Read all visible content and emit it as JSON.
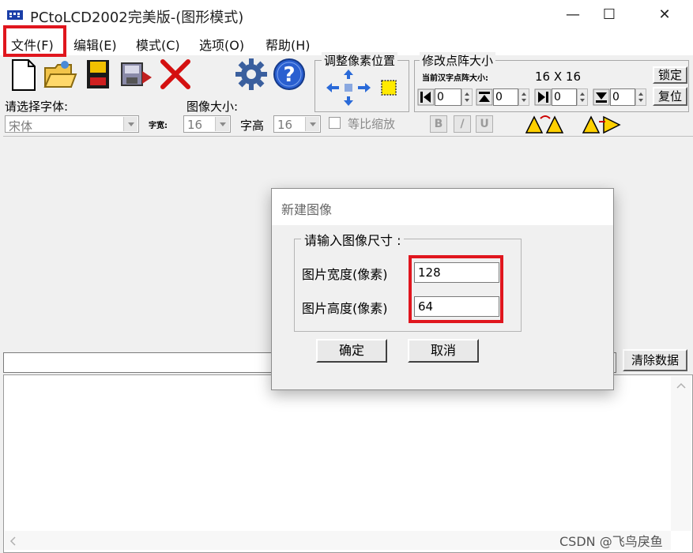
{
  "window": {
    "title": "PCtoLCD2002完美版-(图形模式)",
    "minimize_glyph": "—",
    "maximize_glyph": "☐",
    "close_glyph": "✕"
  },
  "menu": {
    "items": [
      {
        "label": "文件(F)"
      },
      {
        "label": "编辑(E)"
      },
      {
        "label": "模式(C)"
      },
      {
        "label": "选项(O)"
      },
      {
        "label": "帮助(H)"
      }
    ]
  },
  "toolbar": {
    "font_label": "请选择字体:",
    "font_value": "宋体",
    "image_size_label": "图像大小:",
    "char_width_label": "字宽:",
    "char_width_value": "16",
    "char_height_label": "字高",
    "char_height_value": "16",
    "proportional_label": "等比缩放",
    "adjust_pixel_group": "调整像素位置",
    "resize_group": "修改点阵大小",
    "current_size_label": "当前汉字点阵大小:",
    "current_size_value": "16 X 16",
    "lock_button": "锁定",
    "reset_button": "复位",
    "spin_values": [
      "0",
      "0",
      "0",
      "0"
    ],
    "bold_label": "B",
    "italic_label": "/",
    "underline_label": "U",
    "clear_data_button": "清除数据"
  },
  "dialog": {
    "title": "新建图像",
    "group_title": "请输入图像尺寸 :",
    "width_label": "图片宽度(像素)",
    "width_value": "128",
    "height_label": "图片高度(像素)",
    "height_value": "64",
    "ok_button": "确定",
    "cancel_button": "取消"
  },
  "watermark": "CSDN @飞鸟戾鱼",
  "colors": {
    "highlight": "#e0161e",
    "gear": "#3a5f9e",
    "help": "#2a5fd0",
    "delete": "#d41010"
  }
}
